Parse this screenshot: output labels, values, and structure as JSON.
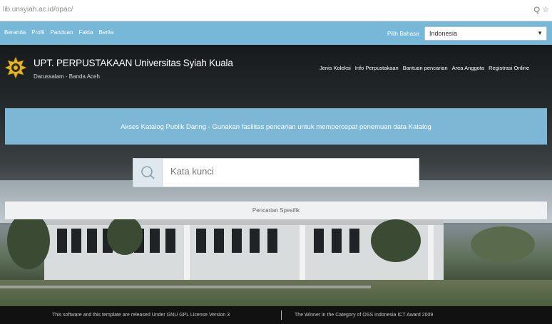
{
  "browser": {
    "url": "lib.unsyiah.ac.id/opac/",
    "tools": "Q ☆"
  },
  "topbar": {
    "links": [
      "Beranda",
      "Profil",
      "Panduan",
      "Fakta",
      "Berita"
    ],
    "language_label": "Pilih Bahasa",
    "language_value": "Indonesia"
  },
  "header": {
    "title": "UPT. PERPUSTAKAAN Universitas Syiah Kuala",
    "subtitle": "Darussalam - Banda Aceh",
    "nav": [
      "Jenis Koleksi",
      "Info Perpustakaan",
      "Bantuan pencarian",
      "Area Anggota",
      "Registrasi Online"
    ]
  },
  "banner": {
    "text": "Akses Katalog Publik Daring - Gunakan fasilitas pencarian untuk mempercepat penemuan data Katalog"
  },
  "search": {
    "placeholder": "Kata kunci"
  },
  "specific_search": {
    "label": "Pencarian Spesifik"
  },
  "footer": {
    "left": "This software and this template are released Under GNU GPL License Version 3",
    "right": "The Winner in the Category of OSS Indonesia ICT Award 2009"
  },
  "colors": {
    "accent_blue": "#77b7d8",
    "banner_blue": "#7db7d6",
    "footer": "#111111"
  }
}
